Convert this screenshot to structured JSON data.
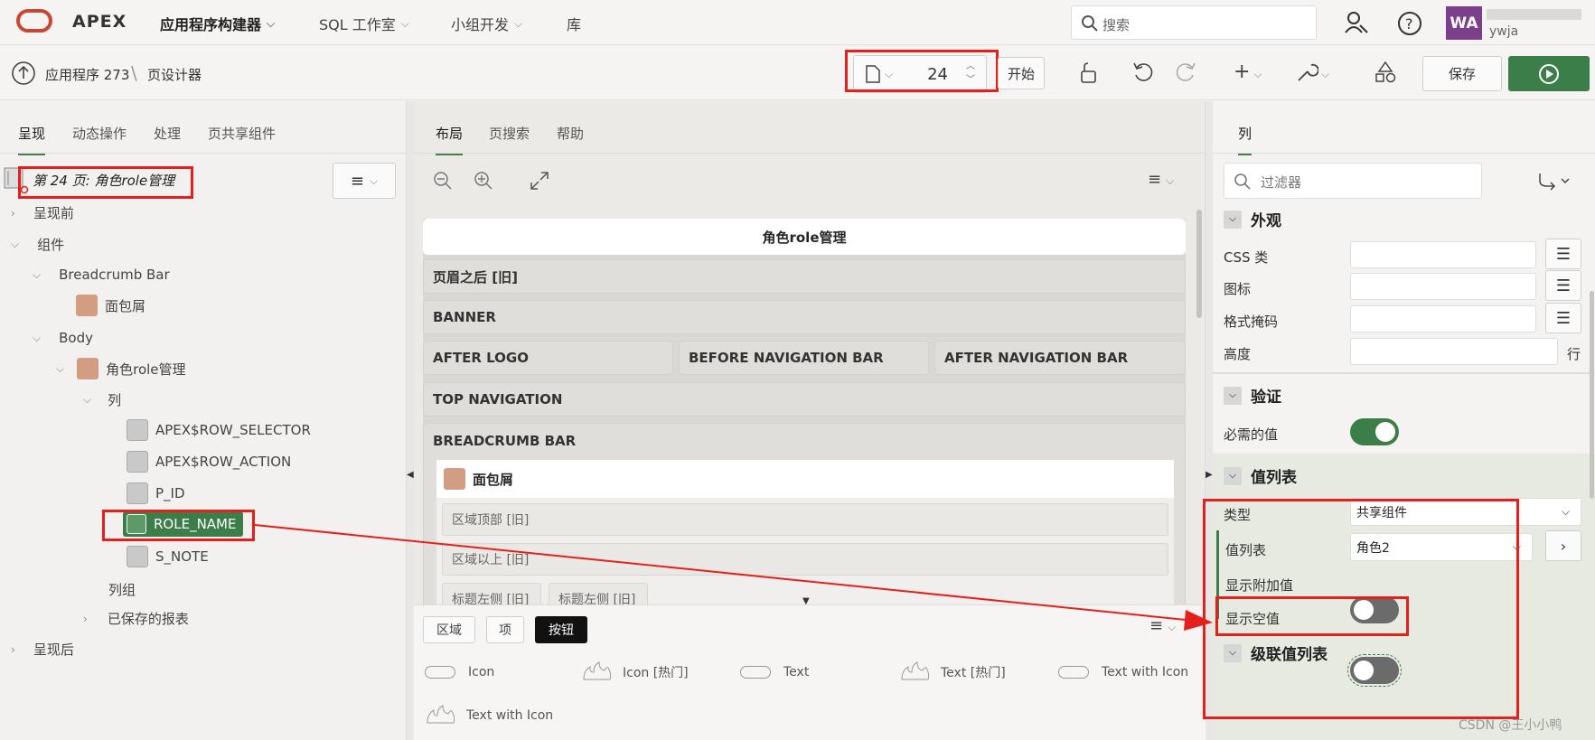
{
  "topbar": {
    "brand": "APEX",
    "nav": [
      "应用程序构建器",
      "SQL 工作室",
      "小组开发",
      "库"
    ],
    "search_placeholder": "搜索",
    "avatar_initials": "WA",
    "username": "ywja"
  },
  "toolbar": {
    "app_crumb": "应用程序 273",
    "page_designer": "页设计器",
    "page_number": "24",
    "start_label": "开始",
    "save_label": "保存"
  },
  "left": {
    "tabs": [
      "呈现",
      "动态操作",
      "处理",
      "页共享组件"
    ],
    "page_title": "第 24 页: 角色role管理",
    "tree": {
      "before": "呈现前",
      "components": "组件",
      "breadcrumb_bar": "Breadcrumb Bar",
      "breadcrumb": "面包屑",
      "body": "Body",
      "region": "角色role管理",
      "columns": "列",
      "cols": [
        "APEX$ROW_SELECTOR",
        "APEX$ROW_ACTION",
        "P_ID",
        "ROLE_NAME",
        "S_NOTE"
      ],
      "column_groups": "列组",
      "saved_reports": "已保存的报表",
      "after": "呈现后"
    }
  },
  "middle": {
    "tabs": [
      "布局",
      "页搜索",
      "帮助"
    ],
    "page_header": "角色role管理",
    "regions": {
      "after_header": "页眉之后 [旧]",
      "banner": "BANNER",
      "after_logo": "AFTER LOGO",
      "before_nav": "BEFORE NAVIGATION BAR",
      "after_nav": "AFTER NAVIGATION BAR",
      "top_nav": "TOP NAVIGATION",
      "breadcrumb_bar": "BREADCRUMB BAR",
      "breadcrumb": "面包屑",
      "region_top": "区域顶部 [旧]",
      "region_above": "区域以上 [旧]",
      "title_left1": "标题左侧 [旧]",
      "title_left2": "标题左侧 [旧]"
    },
    "gallery_tabs": [
      "区域",
      "项",
      "按钮"
    ],
    "gallery_items": [
      "Icon",
      "Icon [热门]",
      "Text",
      "Text [热门]",
      "Text with Icon",
      "Text with Icon"
    ]
  },
  "right": {
    "tab": "列",
    "filter_placeholder": "过滤器",
    "sections": {
      "appearance": "外观",
      "css_class": "CSS 类",
      "icon": "图标",
      "format_mask": "格式掩码",
      "height": "高度",
      "rows_suffix": "行",
      "validation": "验证",
      "required": "必需的值",
      "lov": "值列表",
      "type": "类型",
      "type_value": "共享组件",
      "lov_label": "值列表",
      "lov_value": "角色2",
      "display_extra": "显示附加值",
      "display_null": "显示空值",
      "cascade": "级联值列表"
    }
  },
  "watermark": "CSDN @王小小鸭",
  "colors": {
    "accent": "#3c7e4a",
    "highlight": "#e5201c",
    "brand": "#c74634"
  }
}
